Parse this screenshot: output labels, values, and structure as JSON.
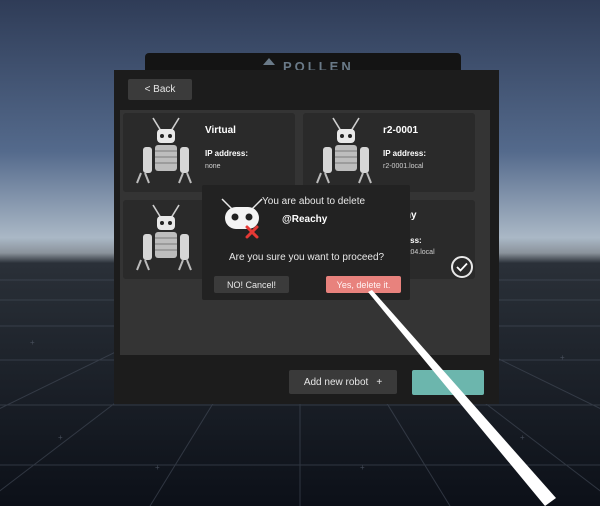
{
  "back_label": "< Back",
  "logo_text": "POLLEN",
  "robots": [
    {
      "name": "Virtual",
      "ip_label": "IP address:",
      "ip_value": "none",
      "selected": false
    },
    {
      "name": "r2-0001",
      "ip_label": "IP address:",
      "ip_value": "r2-0001.local",
      "selected": false
    },
    {
      "name": "",
      "ip_label": "",
      "ip_value": "",
      "selected": false
    },
    {
      "name": "...chy",
      "ip_label": "...ess:",
      "ip_value": "...-pvt04.local",
      "selected": true
    }
  ],
  "dialog": {
    "title": "You are about to delete",
    "robot_name": "@Reachy",
    "question": "Are you sure you want to proceed?",
    "cancel_label": "NO! Cancel!",
    "confirm_label": "Yes, delete it."
  },
  "footer": {
    "add_robot_label": "Add new robot",
    "add_icon": "+"
  },
  "colors": {
    "accent_teal": "#6cb6ad",
    "danger": "#e8827d",
    "panel": "#1c1c1c"
  }
}
